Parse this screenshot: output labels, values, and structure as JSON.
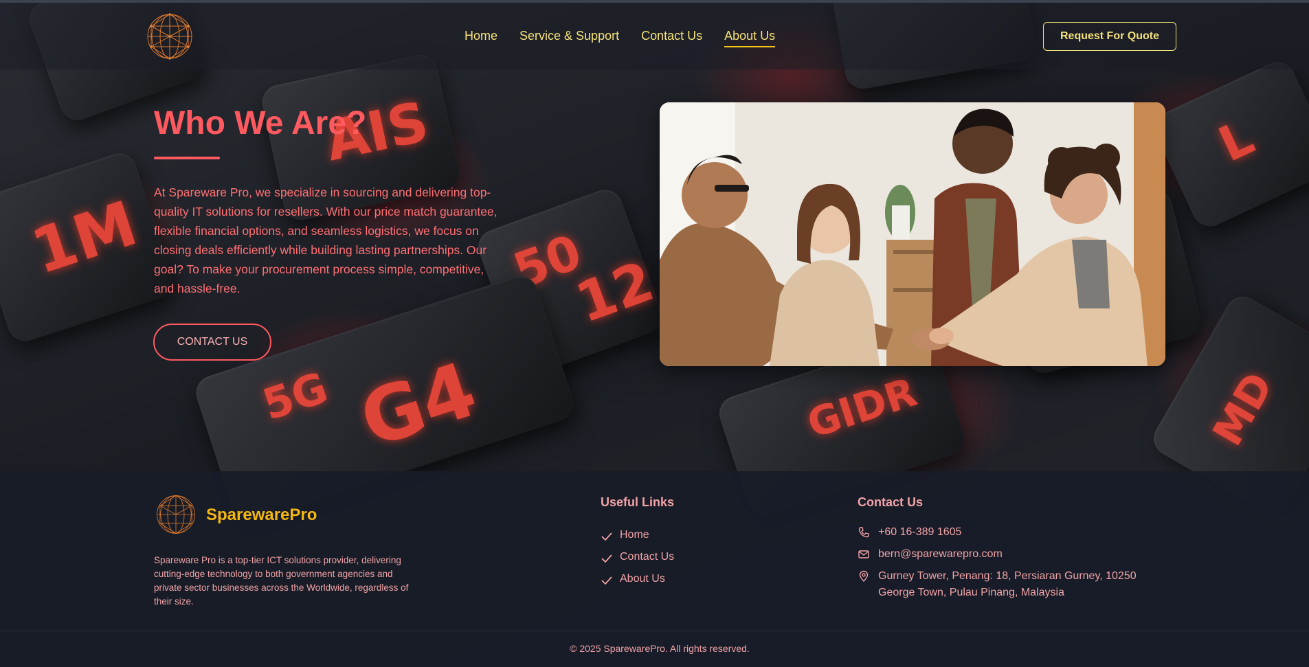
{
  "header": {
    "logo_name": "globe-logo",
    "nav": [
      {
        "label": "Home",
        "active": false
      },
      {
        "label": "Service & Support",
        "active": false
      },
      {
        "label": "Contact Us",
        "active": false
      },
      {
        "label": "About Us",
        "active": true
      }
    ],
    "cta_label": "Request For Quote"
  },
  "hero": {
    "title": "Who We Are?",
    "body": "At Spareware Pro, we specialize in sourcing and delivering top-quality IT solutions for resellers. With our price match guarantee, flexible financial options, and seamless logistics, we focus on closing deals efficiently while building lasting partnerships. Our goal? To make your procurement process simple, competitive, and hassle-free.",
    "button_label": "CONTACT US"
  },
  "footer": {
    "brand": "SparewarePro",
    "description": "Spareware Pro is a top-tier ICT solutions provider, delivering cutting-edge technology to both government agencies and private sector businesses across the Worldwide, regardless of their size.",
    "useful_links_title": "Useful Links",
    "useful_links": [
      "Home",
      "Contact Us",
      "About Us"
    ],
    "contact_title": "Contact Us",
    "phone": "+60 16-389 1605",
    "email": "bern@sparewarepro.com",
    "address": "Gurney Tower, Penang: 18, Persiaran Gurney, 10250 George Town, Pulau Pinang, Malaysia",
    "copyright": "© 2025 SparewarePro. All rights reserved."
  },
  "colors": {
    "accent_red": "#ff5a5f",
    "nav_yellow": "#f5e27a",
    "brand_gold": "#f5b614",
    "footer_text": "#f1a3a6"
  }
}
